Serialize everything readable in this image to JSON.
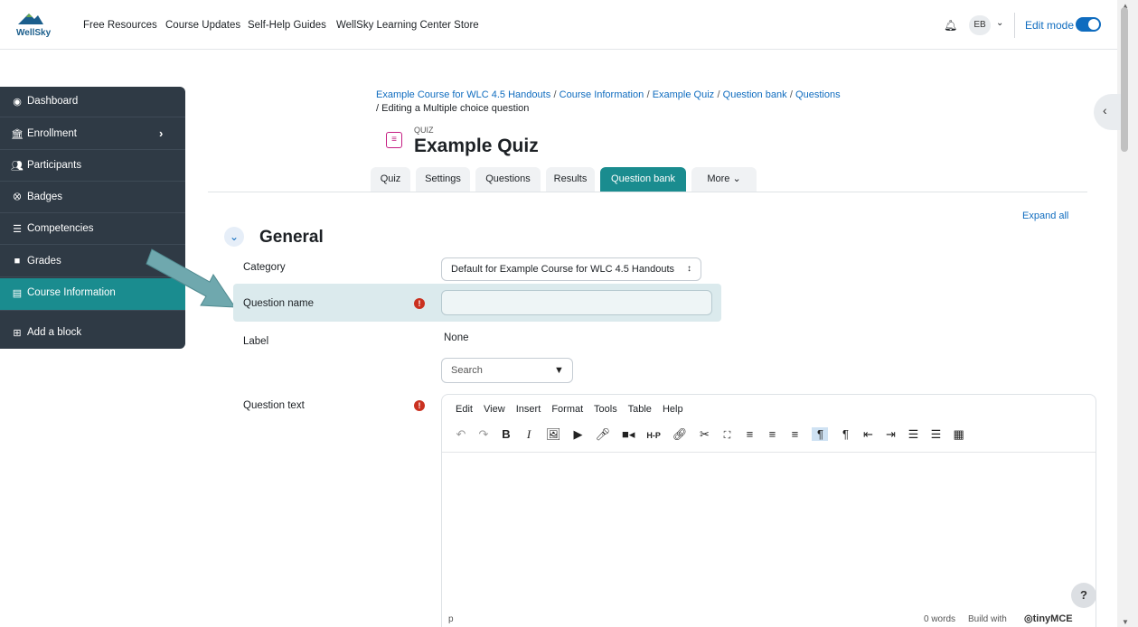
{
  "topnav": {
    "logo_text": "WellSky",
    "links": [
      "Free Resources",
      "Course Updates",
      "Self-Help Guides",
      "WellSky Learning Center Store"
    ],
    "avatar_initials": "EB",
    "edit_mode_label": "Edit mode",
    "edit_mode_on": true
  },
  "sidebar": {
    "items": [
      {
        "label": "Dashboard",
        "icon": "dashboard-icon"
      },
      {
        "label": "Enrollment",
        "icon": "bank-icon"
      },
      {
        "label": "Participants",
        "icon": "users-icon"
      },
      {
        "label": "Badges",
        "icon": "badge-icon"
      },
      {
        "label": "Competencies",
        "icon": "list-icon"
      },
      {
        "label": "Grades",
        "icon": "clipboard-icon"
      },
      {
        "label": "Course Information",
        "icon": "card-icon"
      },
      {
        "label": "Add a block",
        "icon": "plus-square-icon"
      }
    ]
  },
  "breadcrumb": {
    "items": [
      "Example Course for WLC 4.5 Handouts",
      "Course Information",
      "Example Quiz",
      "Question bank",
      "Questions"
    ],
    "current": "Editing a Multiple choice question"
  },
  "header": {
    "subtitle": "QUIZ",
    "title": "Example Quiz"
  },
  "tabs": [
    "Quiz",
    "Settings",
    "Questions",
    "Results",
    "Question bank",
    "More"
  ],
  "form": {
    "expand_all": "Expand all",
    "section_title": "General",
    "category_label": "Category",
    "category_value": "Default for Example Course for WLC 4.5 Handouts",
    "question_name_label": "Question name",
    "question_name_value": "",
    "label_label": "Label",
    "label_value": "None",
    "search_placeholder": "Search",
    "question_text_label": "Question text"
  },
  "editor": {
    "menu": [
      "Edit",
      "View",
      "Insert",
      "Format",
      "Tools",
      "Table",
      "Help"
    ],
    "status_path": "p",
    "word_count": "0 words",
    "build_with": "Build with",
    "brand": "tinyMCE"
  },
  "help_label": "?"
}
